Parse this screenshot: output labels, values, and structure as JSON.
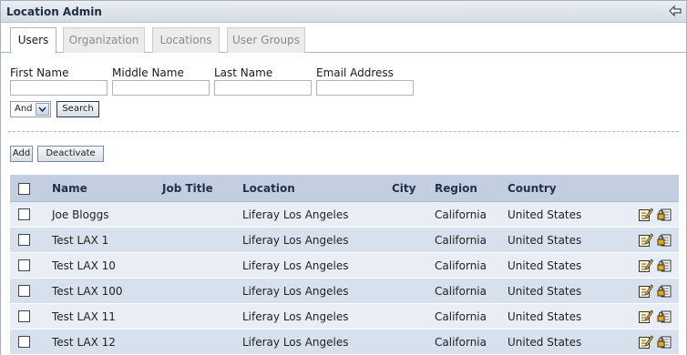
{
  "portlet": {
    "title": "Location Admin"
  },
  "tabs": [
    {
      "label": "Users",
      "active": true
    },
    {
      "label": "Organization",
      "active": false
    },
    {
      "label": "Locations",
      "active": false
    },
    {
      "label": "User Groups",
      "active": false
    }
  ],
  "search_form": {
    "fields": [
      {
        "label": "First Name",
        "value": ""
      },
      {
        "label": "Middle Name",
        "value": ""
      },
      {
        "label": "Last Name",
        "value": ""
      },
      {
        "label": "Email Address",
        "value": ""
      }
    ],
    "operator": {
      "selected": "And"
    },
    "search_label": "Search"
  },
  "actions": {
    "add_label": "Add",
    "deactivate_label": "Deactivate"
  },
  "table": {
    "columns": [
      "Name",
      "Job Title",
      "Location",
      "City",
      "Region",
      "Country"
    ],
    "rows": [
      {
        "name": "Joe Bloggs",
        "job_title": "",
        "location": "Liferay Los Angeles",
        "city": "",
        "region": "California",
        "country": "United States"
      },
      {
        "name": "Test LAX 1",
        "job_title": "",
        "location": "Liferay Los Angeles",
        "city": "",
        "region": "California",
        "country": "United States"
      },
      {
        "name": "Test LAX 10",
        "job_title": "",
        "location": "Liferay Los Angeles",
        "city": "",
        "region": "California",
        "country": "United States"
      },
      {
        "name": "Test LAX 100",
        "job_title": "",
        "location": "Liferay Los Angeles",
        "city": "",
        "region": "California",
        "country": "United States"
      },
      {
        "name": "Test LAX 11",
        "job_title": "",
        "location": "Liferay Los Angeles",
        "city": "",
        "region": "California",
        "country": "United States"
      },
      {
        "name": "Test LAX 12",
        "job_title": "",
        "location": "Liferay Los Angeles",
        "city": "",
        "region": "California",
        "country": "United States"
      }
    ],
    "row_icons": [
      "edit-icon",
      "permissions-icon"
    ]
  },
  "colors": {
    "header_bg": "#c3cee0",
    "row_odd": "#e9eef6",
    "row_even": "#d7e1ee",
    "accent": "#22324a"
  }
}
